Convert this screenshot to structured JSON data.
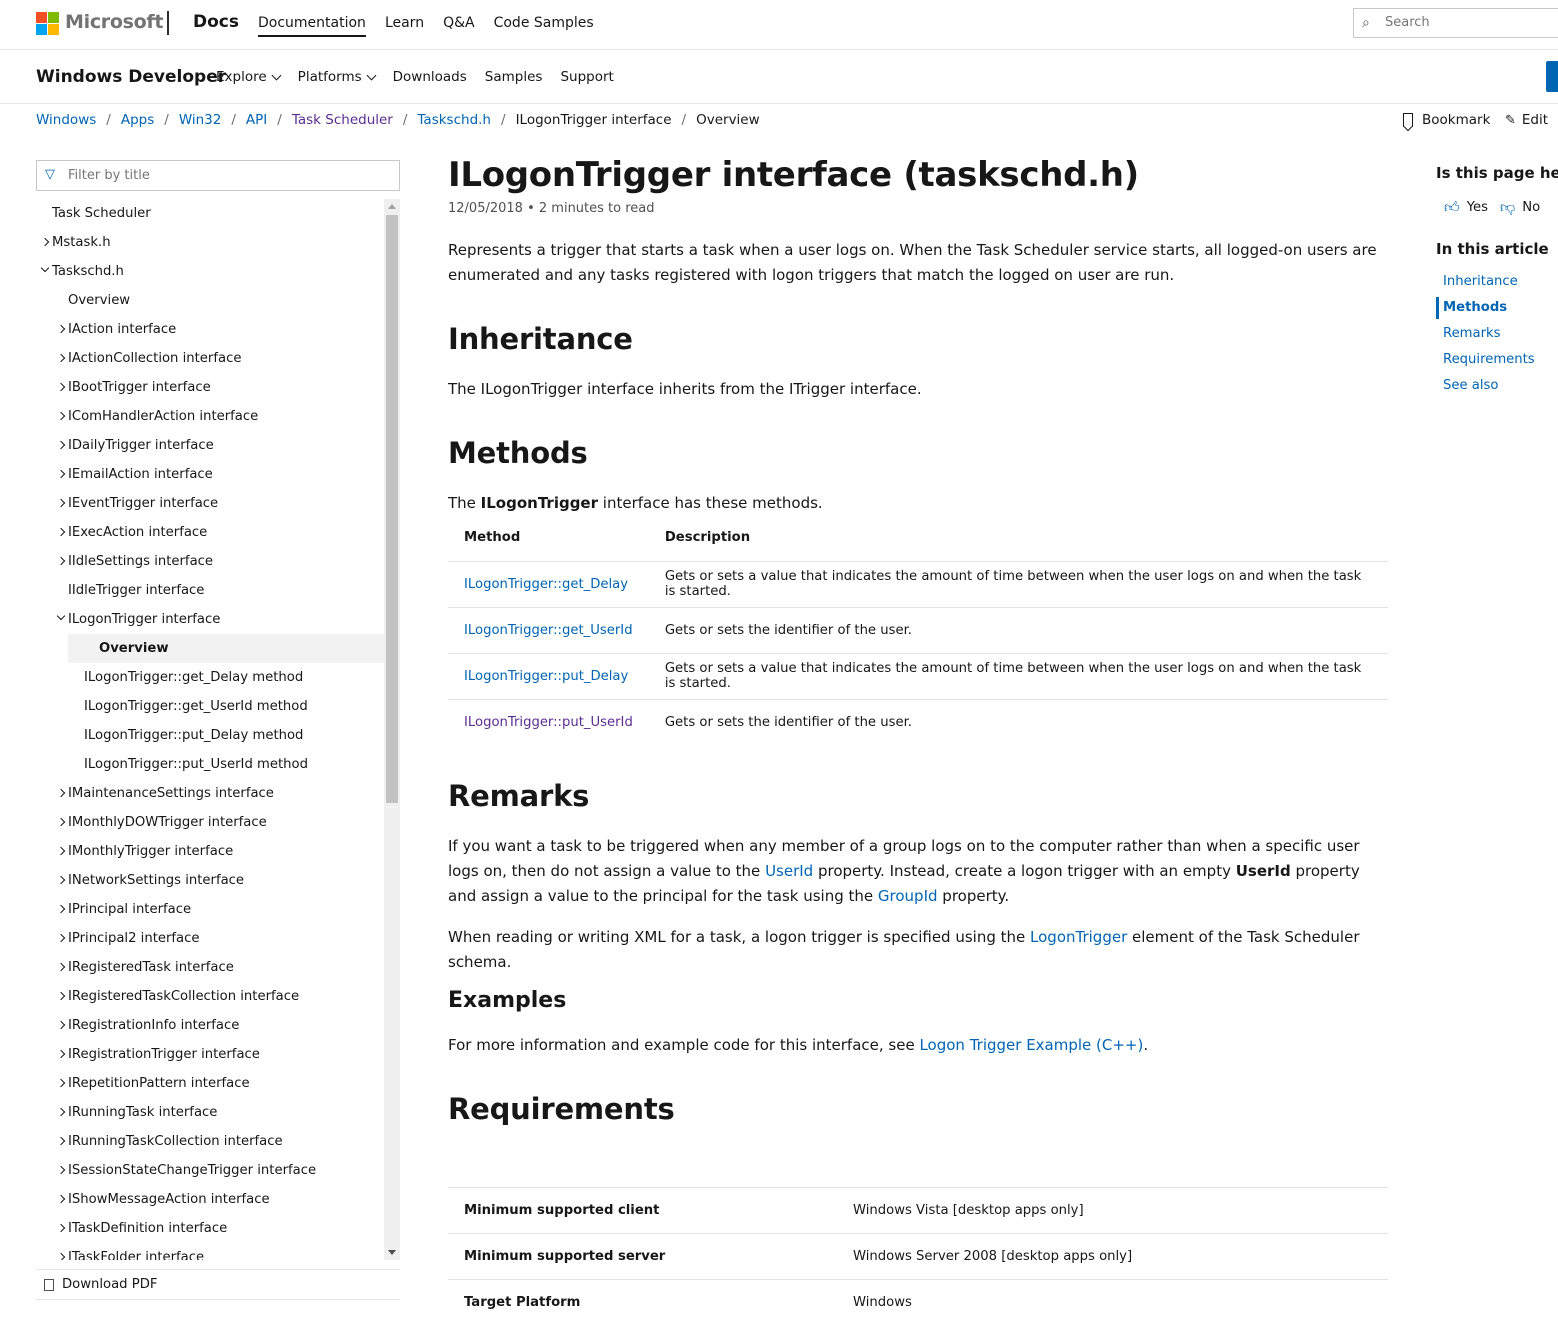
{
  "brand": {
    "microsoft": "Microsoft",
    "docs": "Docs",
    "logo_colors": [
      "#f25022",
      "#7fba00",
      "#00a4ef",
      "#ffb900"
    ]
  },
  "top_nav": [
    {
      "label": "Documentation",
      "active": true
    },
    {
      "label": "Learn"
    },
    {
      "label": "Q&A"
    },
    {
      "label": "Code Samples"
    }
  ],
  "search": {
    "placeholder": "Search",
    "icon": "search-icon"
  },
  "product": {
    "title": "Windows Developer",
    "nav": [
      {
        "label": "Explore",
        "dropdown": true
      },
      {
        "label": "Platforms",
        "dropdown": true
      },
      {
        "label": "Downloads"
      },
      {
        "label": "Samples"
      },
      {
        "label": "Support"
      }
    ]
  },
  "breadcrumb": [
    "Windows",
    "Apps",
    "Win32",
    "API",
    "Task Scheduler",
    "Taskschd.h",
    "ILogonTrigger interface",
    "Overview"
  ],
  "actions": {
    "bookmark": "Bookmark",
    "edit": "Edit"
  },
  "toc": {
    "filter_placeholder": "Filter by title",
    "items": [
      {
        "label": "Task Scheduler",
        "level": 0,
        "arrow": "none"
      },
      {
        "label": "Mstask.h",
        "level": 0,
        "arrow": "closed"
      },
      {
        "label": "Taskschd.h",
        "level": 0,
        "arrow": "open"
      },
      {
        "label": "Overview",
        "level": 1,
        "arrow": "none"
      },
      {
        "label": "IAction interface",
        "level": 1,
        "arrow": "closed"
      },
      {
        "label": "IActionCollection interface",
        "level": 1,
        "arrow": "closed"
      },
      {
        "label": "IBootTrigger interface",
        "level": 1,
        "arrow": "closed"
      },
      {
        "label": "IComHandlerAction interface",
        "level": 1,
        "arrow": "closed"
      },
      {
        "label": "IDailyTrigger interface",
        "level": 1,
        "arrow": "closed"
      },
      {
        "label": "IEmailAction interface",
        "level": 1,
        "arrow": "closed"
      },
      {
        "label": "IEventTrigger interface",
        "level": 1,
        "arrow": "closed"
      },
      {
        "label": "IExecAction interface",
        "level": 1,
        "arrow": "closed"
      },
      {
        "label": "IIdleSettings interface",
        "level": 1,
        "arrow": "closed"
      },
      {
        "label": "IIdleTrigger interface",
        "level": 1,
        "arrow": "none"
      },
      {
        "label": "ILogonTrigger interface",
        "level": 1,
        "arrow": "open"
      },
      {
        "label": "Overview",
        "level": 2,
        "arrow": "none",
        "active": true
      },
      {
        "label": "ILogonTrigger::get_Delay method",
        "level": 2,
        "arrow": "none"
      },
      {
        "label": "ILogonTrigger::get_UserId method",
        "level": 2,
        "arrow": "none"
      },
      {
        "label": "ILogonTrigger::put_Delay method",
        "level": 2,
        "arrow": "none"
      },
      {
        "label": "ILogonTrigger::put_UserId method",
        "level": 2,
        "arrow": "none"
      },
      {
        "label": "IMaintenanceSettings interface",
        "level": 1,
        "arrow": "closed"
      },
      {
        "label": "IMonthlyDOWTrigger interface",
        "level": 1,
        "arrow": "closed"
      },
      {
        "label": "IMonthlyTrigger interface",
        "level": 1,
        "arrow": "closed"
      },
      {
        "label": "INetworkSettings interface",
        "level": 1,
        "arrow": "closed"
      },
      {
        "label": "IPrincipal interface",
        "level": 1,
        "arrow": "closed"
      },
      {
        "label": "IPrincipal2 interface",
        "level": 1,
        "arrow": "closed"
      },
      {
        "label": "IRegisteredTask interface",
        "level": 1,
        "arrow": "closed"
      },
      {
        "label": "IRegisteredTaskCollection interface",
        "level": 1,
        "arrow": "closed"
      },
      {
        "label": "IRegistrationInfo interface",
        "level": 1,
        "arrow": "closed"
      },
      {
        "label": "IRegistrationTrigger interface",
        "level": 1,
        "arrow": "closed"
      },
      {
        "label": "IRepetitionPattern interface",
        "level": 1,
        "arrow": "closed"
      },
      {
        "label": "IRunningTask interface",
        "level": 1,
        "arrow": "closed"
      },
      {
        "label": "IRunningTaskCollection interface",
        "level": 1,
        "arrow": "closed"
      },
      {
        "label": "ISessionStateChangeTrigger interface",
        "level": 1,
        "arrow": "closed"
      },
      {
        "label": "IShowMessageAction interface",
        "level": 1,
        "arrow": "closed"
      },
      {
        "label": "ITaskDefinition interface",
        "level": 1,
        "arrow": "closed"
      },
      {
        "label": "ITaskFolder interface",
        "level": 1,
        "arrow": "closed"
      }
    ],
    "download_pdf": "Download PDF"
  },
  "article": {
    "title": "ILogonTrigger interface (taskschd.h)",
    "date": "12/05/2018",
    "read_time": "2 minutes to read",
    "intro": "Represents a trigger that starts a task when a user logs on. When the Task Scheduler service starts, all logged-on users are enumerated and any tasks registered with logon triggers that match the logged on user are run.",
    "inheritance_heading": "Inheritance",
    "inheritance_text": "The ILogonTrigger interface inherits from the ITrigger interface.",
    "methods_heading": "Methods",
    "methods_intro_pre": "The ",
    "methods_intro_bold": "ILogonTrigger",
    "methods_intro_post": " interface has these methods.",
    "methods_columns": [
      "Method",
      "Description"
    ],
    "methods": [
      {
        "name": "ILogonTrigger::get_Delay",
        "desc": "Gets or sets a value that indicates the amount of time between when the user logs on and when the task is started.",
        "visited": false
      },
      {
        "name": "ILogonTrigger::get_UserId",
        "desc": "Gets or sets the identifier of the user.",
        "visited": false
      },
      {
        "name": "ILogonTrigger::put_Delay",
        "desc": "Gets or sets a value that indicates the amount of time between when the user logs on and when the task is started.",
        "visited": false
      },
      {
        "name": "ILogonTrigger::put_UserId",
        "desc": "Gets or sets the identifier of the user.",
        "visited": true
      }
    ],
    "remarks_heading": "Remarks",
    "remarks_p1": {
      "a": "If you want a task to be triggered when any member of a group logs on to the computer rather than when a specific user logs on, then do not assign a value to the ",
      "link1": "UserId",
      "b": " property. Instead, create a logon trigger with an empty ",
      "bold": "UserId",
      "c": " property and assign a value to the principal for the task using the ",
      "link2": "GroupId",
      "d": " property."
    },
    "remarks_p2": {
      "a": "When reading or writing XML for a task, a logon trigger is specified using the ",
      "link": "LogonTrigger",
      "b": " element of the Task Scheduler schema."
    },
    "examples_heading": "Examples",
    "examples_text": {
      "a": "For more information and example code for this interface, see ",
      "link": "Logon Trigger Example (C++)",
      "b": "."
    },
    "requirements_heading": "Requirements",
    "requirements": [
      {
        "label": "Minimum supported client",
        "value": "Windows Vista [desktop apps only]"
      },
      {
        "label": "Minimum supported server",
        "value": "Windows Server 2008 [desktop apps only]"
      },
      {
        "label": "Target Platform",
        "value": "Windows"
      }
    ]
  },
  "rail": {
    "helpful_question": "Is this page helpful?",
    "yes": "Yes",
    "no": "No",
    "in_this_article": "In this article",
    "links": [
      {
        "label": "Inheritance"
      },
      {
        "label": "Methods",
        "active": true
      },
      {
        "label": "Remarks"
      },
      {
        "label": "Requirements"
      },
      {
        "label": "See also"
      }
    ]
  }
}
